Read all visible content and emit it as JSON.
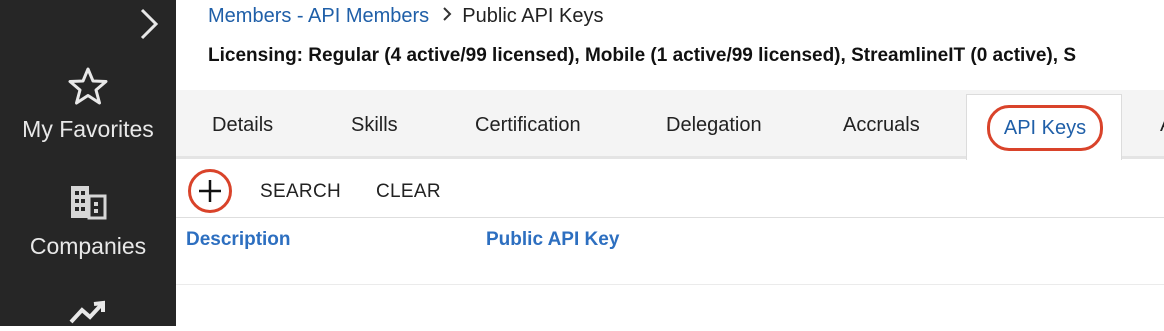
{
  "sidebar": {
    "items": [
      {
        "label": "My Favorites",
        "icon": "star-icon"
      },
      {
        "label": "Companies",
        "icon": "building-icon"
      },
      {
        "label": "",
        "icon": "trend-chart-icon"
      }
    ],
    "expand_icon": "chevron-right-icon"
  },
  "breadcrumb": {
    "parent": "Members - API Members",
    "current": "Public API Keys"
  },
  "licensing": "Licensing: Regular (4 active/99 licensed), Mobile (1 active/99 licensed), StreamlineIT (0 active), S",
  "tabs": [
    {
      "label": "Details"
    },
    {
      "label": "Skills"
    },
    {
      "label": "Certification"
    },
    {
      "label": "Delegation"
    },
    {
      "label": "Accruals"
    },
    {
      "label": "API Keys",
      "active": true
    },
    {
      "label": "A"
    }
  ],
  "toolbar": {
    "add_icon": "plus-icon",
    "search_label": "SEARCH",
    "clear_label": "CLEAR"
  },
  "table": {
    "columns": [
      "Description",
      "Public API Key"
    ]
  },
  "colors": {
    "sidebar_bg": "#262626",
    "link_blue": "#1f5fa8",
    "header_blue": "#2d6fc0",
    "highlight_red": "#d9432a"
  }
}
